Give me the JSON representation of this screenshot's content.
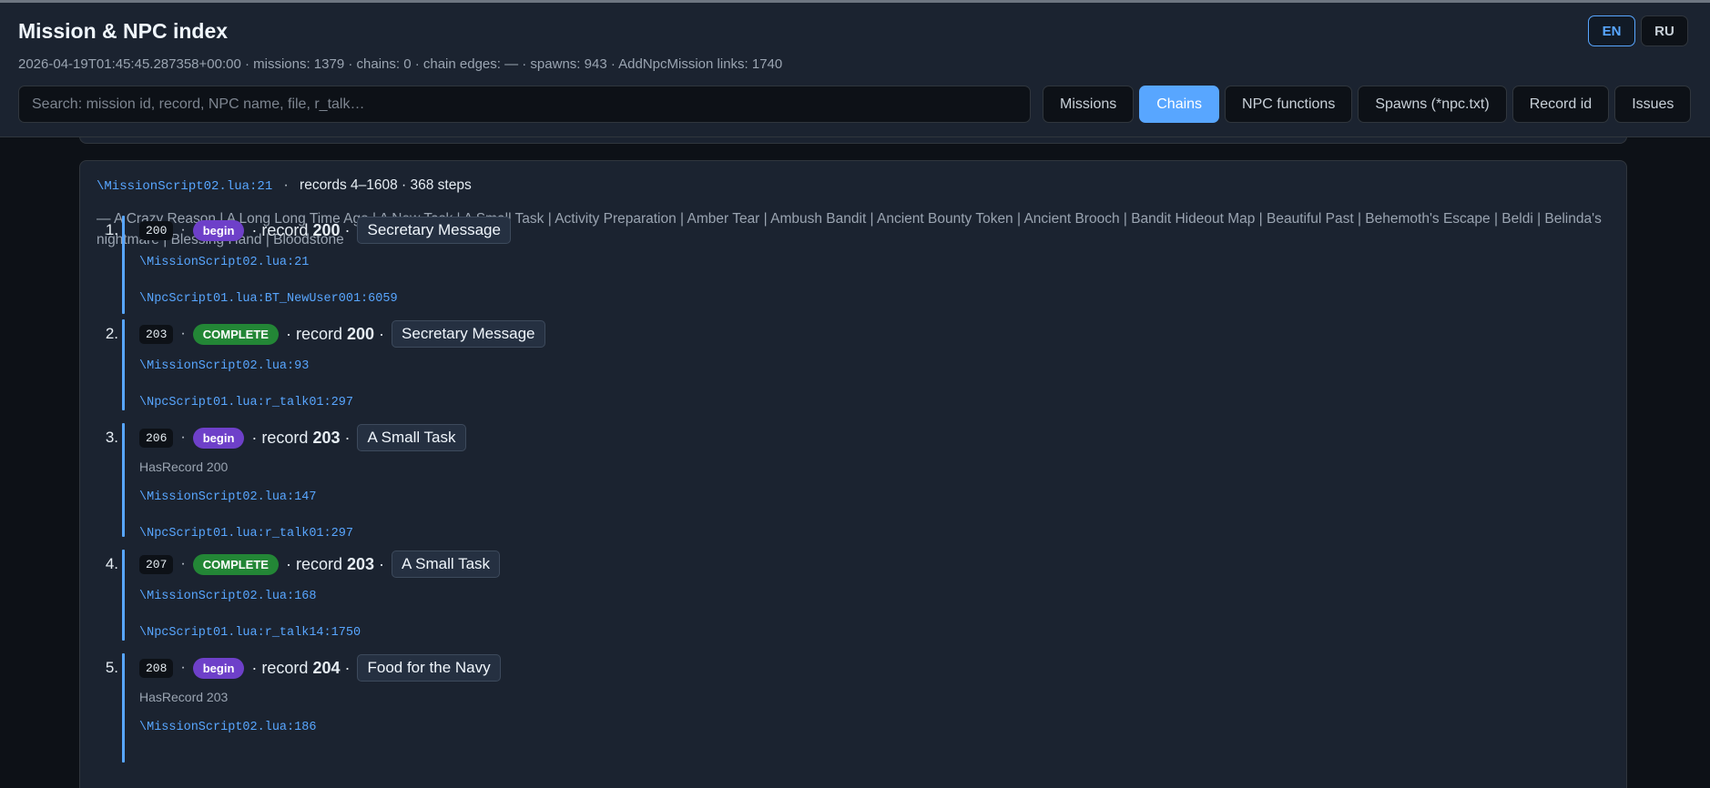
{
  "header": {
    "title": "Mission & NPC index",
    "meta": "2026-04-19T01:45:45.287358+00:00 · missions: 1379 · chains: 0 · chain edges: — · spawns: 943 · AddNpcMission links: 1740",
    "languages": [
      {
        "label": "EN",
        "active": true
      },
      {
        "label": "RU",
        "active": false
      }
    ],
    "search_placeholder": "Search: mission id, record, NPC name, file, r_talk…",
    "tabs": [
      {
        "label": "Missions",
        "active": false
      },
      {
        "label": "Chains",
        "active": true
      },
      {
        "label": "NPC functions",
        "active": false
      },
      {
        "label": "Spawns (*npc.txt)",
        "active": false
      },
      {
        "label": "Record id",
        "active": false
      },
      {
        "label": "Issues",
        "active": false
      }
    ]
  },
  "chain": {
    "file": "\\MissionScript02.lua:21",
    "sep": "·",
    "summary": "records 4–1608 · 368 steps",
    "names": "— A Crazy Reason | A Long Long Time Ago | A New Task | A Small Task | Activity Preparation | Amber Tear | Ambush Bandit | Ancient Bounty Token | Ancient Brooch | Bandit Hideout Map | Beautiful Past | Behemoth's Escape | Beldi | Belinda's nightmare | Blessing Hand | Bloodstone",
    "steps": [
      {
        "num": "1.",
        "mission_id": "200",
        "status": "begin",
        "record_label": "record",
        "record": "200",
        "name": "Secretary Message",
        "condition": "",
        "links": [
          "\\MissionScript02.lua:21",
          "\\NpcScript01.lua:BT_NewUser001:6059"
        ]
      },
      {
        "num": "2.",
        "mission_id": "203",
        "status": "COMPLETE",
        "record_label": "record",
        "record": "200",
        "name": "Secretary Message",
        "condition": "",
        "links": [
          "\\MissionScript02.lua:93",
          "\\NpcScript01.lua:r_talk01:297"
        ]
      },
      {
        "num": "3.",
        "mission_id": "206",
        "status": "begin",
        "record_label": "record",
        "record": "203",
        "name": "A Small Task",
        "condition": "HasRecord 200",
        "links": [
          "\\MissionScript02.lua:147",
          "\\NpcScript01.lua:r_talk01:297"
        ]
      },
      {
        "num": "4.",
        "mission_id": "207",
        "status": "COMPLETE",
        "record_label": "record",
        "record": "203",
        "name": "A Small Task",
        "condition": "",
        "links": [
          "\\MissionScript02.lua:168",
          "\\NpcScript01.lua:r_talk14:1750"
        ]
      },
      {
        "num": "5.",
        "mission_id": "208",
        "status": "begin",
        "record_label": "record",
        "record": "204",
        "name": "Food for the Navy",
        "condition": "HasRecord 203",
        "links": [
          "\\MissionScript02.lua:186"
        ]
      }
    ]
  },
  "colors": {
    "accent": "#58a6ff",
    "begin_badge": "#6e40c9",
    "complete_badge": "#238636",
    "header_bg": "#1b2330",
    "page_bg": "#0d1117"
  }
}
